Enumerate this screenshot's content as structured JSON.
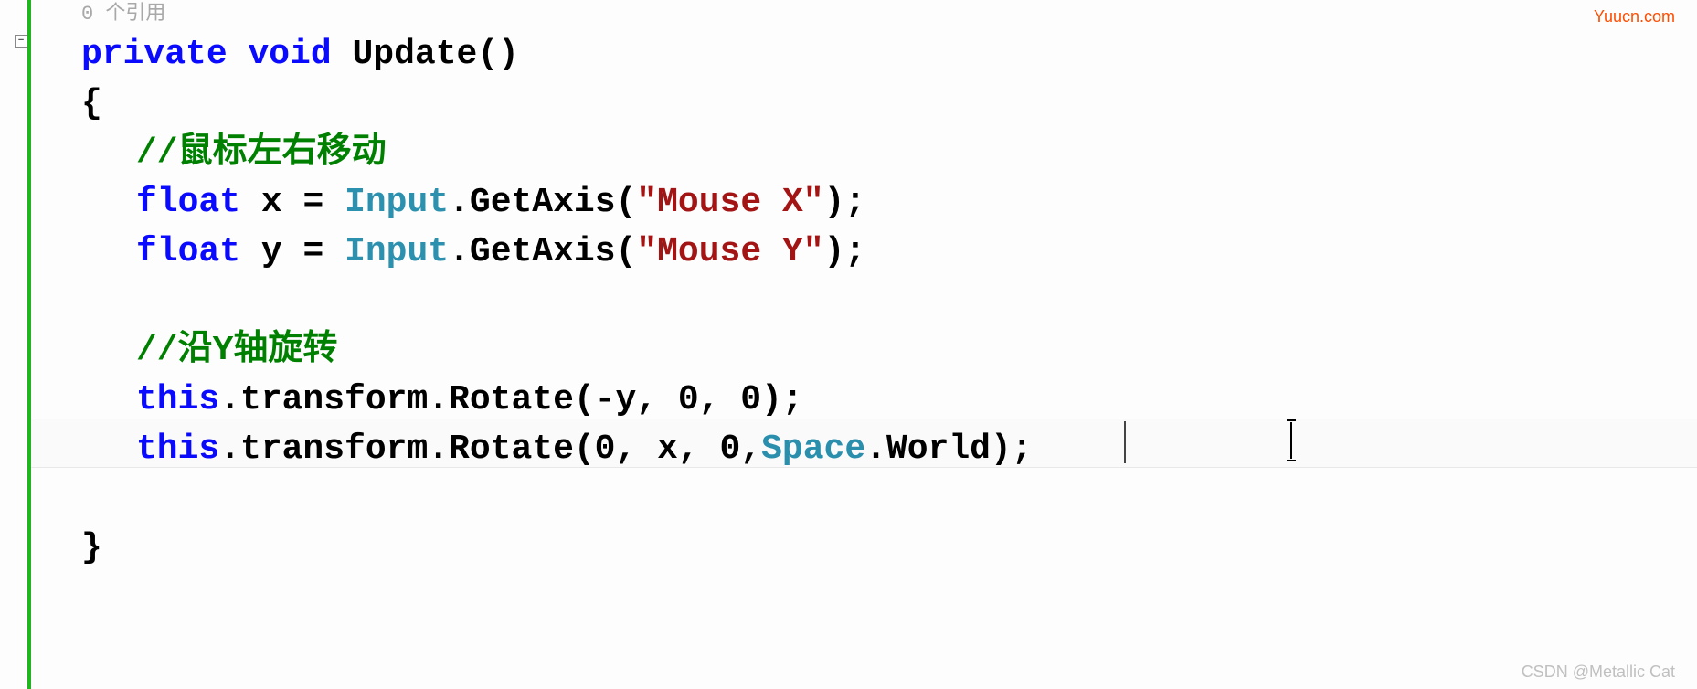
{
  "editor": {
    "reference_hint": "0 个引用",
    "fold_symbol": "−",
    "code": {
      "line1": {
        "private": "private",
        "void": "void",
        "update": "Update",
        "paren": "()"
      },
      "brace_open": "{",
      "comment1": "//鼠标左右移动",
      "line_x": {
        "float": "float",
        "var": " x = ",
        "input": "Input",
        "dot_get": ".GetAxis(",
        "str": "\"Mouse X\"",
        "end": ");"
      },
      "line_y": {
        "float": "float",
        "var": " y = ",
        "input": "Input",
        "dot_get": ".GetAxis(",
        "str": "\"Mouse Y\"",
        "end": ");"
      },
      "comment2": "//沿Y轴旋转",
      "rotate1": {
        "this": "this",
        "rest": ".transform.Rotate(-y, 0, 0);"
      },
      "rotate2": {
        "this": "this",
        "mid1": ".transform.Rotate(0, x, 0,",
        "space": "Space",
        "mid2": ".World);"
      },
      "brace_close": "}"
    }
  },
  "watermarks": {
    "top": "Yuucn.com",
    "bottom": "CSDN @Metallic Cat"
  }
}
